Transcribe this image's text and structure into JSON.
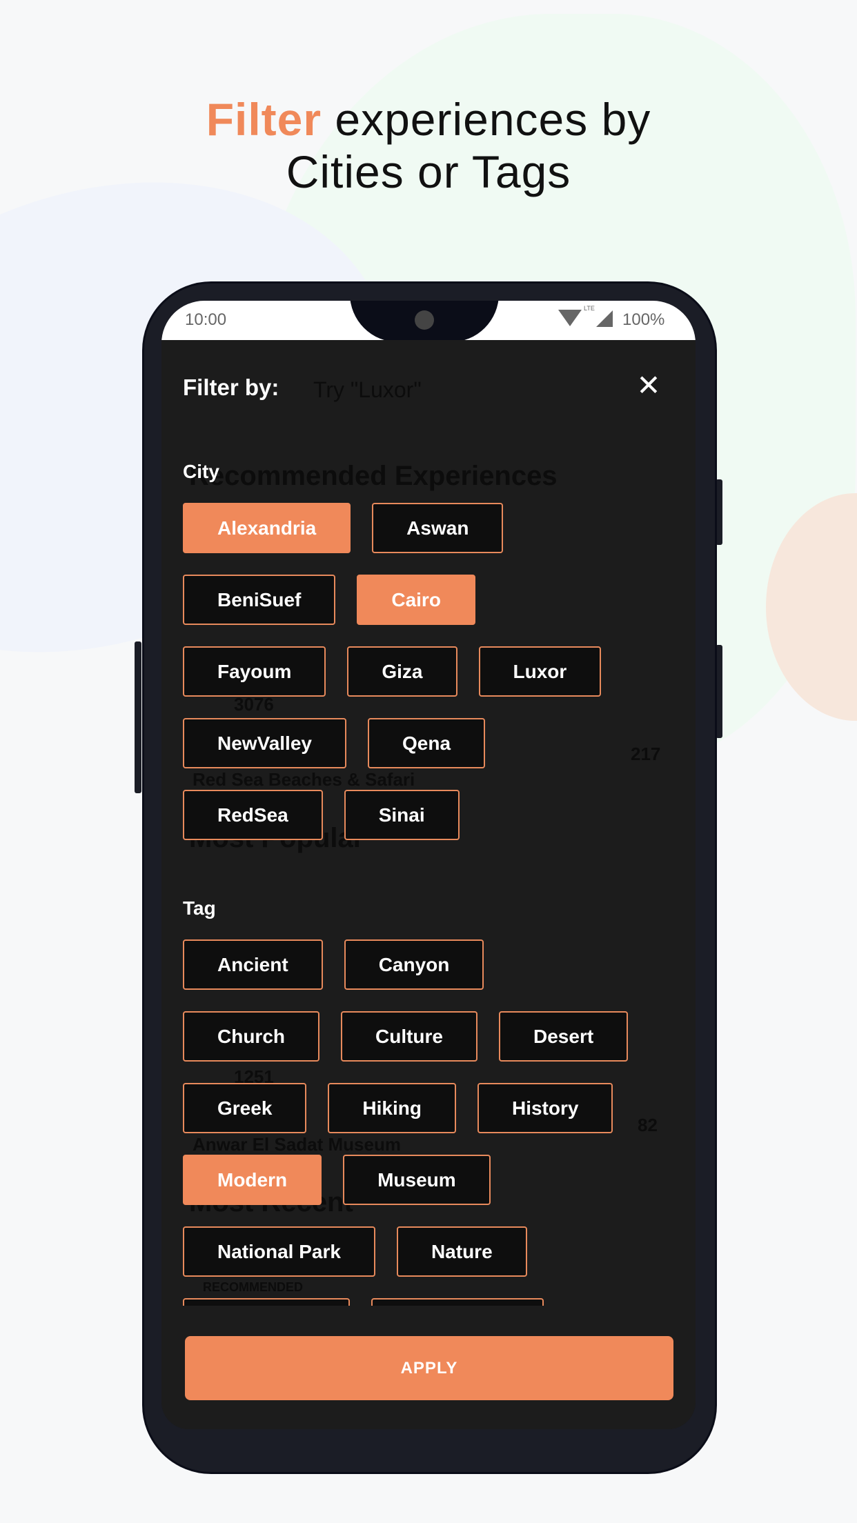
{
  "headline": {
    "accent": "Filter",
    "line1_rest": " experiences by",
    "line2": "Cities or Tags"
  },
  "status_bar": {
    "time": "10:00",
    "battery": "100%",
    "network": "LTE"
  },
  "background_app": {
    "search_placeholder": "Try \"Luxor\"",
    "recommended": "Recommended Experiences",
    "views1": "3076",
    "card1": "Red Sea Beaches & Safari",
    "likes1": "217",
    "popular": "Most Popular",
    "views2": "1251",
    "card2": "Anwar El Sadat Museum",
    "likes2": "82",
    "recent": "Most Recent",
    "badge": "RECOMMENDED"
  },
  "filter": {
    "title": "Filter by:",
    "city_label": "City",
    "city_rows": [
      [
        {
          "label": "Alexandria",
          "selected": true
        },
        {
          "label": "Aswan",
          "selected": false
        }
      ],
      [
        {
          "label": "BeniSuef",
          "selected": false
        },
        {
          "label": "Cairo",
          "selected": true
        }
      ],
      [
        {
          "label": "Fayoum",
          "selected": false
        },
        {
          "label": "Giza",
          "selected": false
        },
        {
          "label": "Luxor",
          "selected": false
        }
      ],
      [
        {
          "label": "NewValley",
          "selected": false
        },
        {
          "label": "Qena",
          "selected": false
        }
      ],
      [
        {
          "label": "RedSea",
          "selected": false
        },
        {
          "label": "Sinai",
          "selected": false
        }
      ]
    ],
    "tag_label": "Tag",
    "tag_rows": [
      [
        {
          "label": "Ancient",
          "selected": false
        },
        {
          "label": "Canyon",
          "selected": false
        }
      ],
      [
        {
          "label": "Church",
          "selected": false
        },
        {
          "label": "Culture",
          "selected": false
        },
        {
          "label": "Desert",
          "selected": false
        }
      ],
      [
        {
          "label": "Greek",
          "selected": false
        },
        {
          "label": "Hiking",
          "selected": false
        },
        {
          "label": "History",
          "selected": false
        }
      ],
      [
        {
          "label": "Modern",
          "selected": true
        },
        {
          "label": "Museum",
          "selected": false
        }
      ],
      [
        {
          "label": "National Park",
          "selected": false
        },
        {
          "label": "Nature",
          "selected": false
        }
      ]
    ],
    "apply_label": "APPLY"
  },
  "colors": {
    "accent": "#f0895a",
    "panel": "#1c1c1c"
  }
}
